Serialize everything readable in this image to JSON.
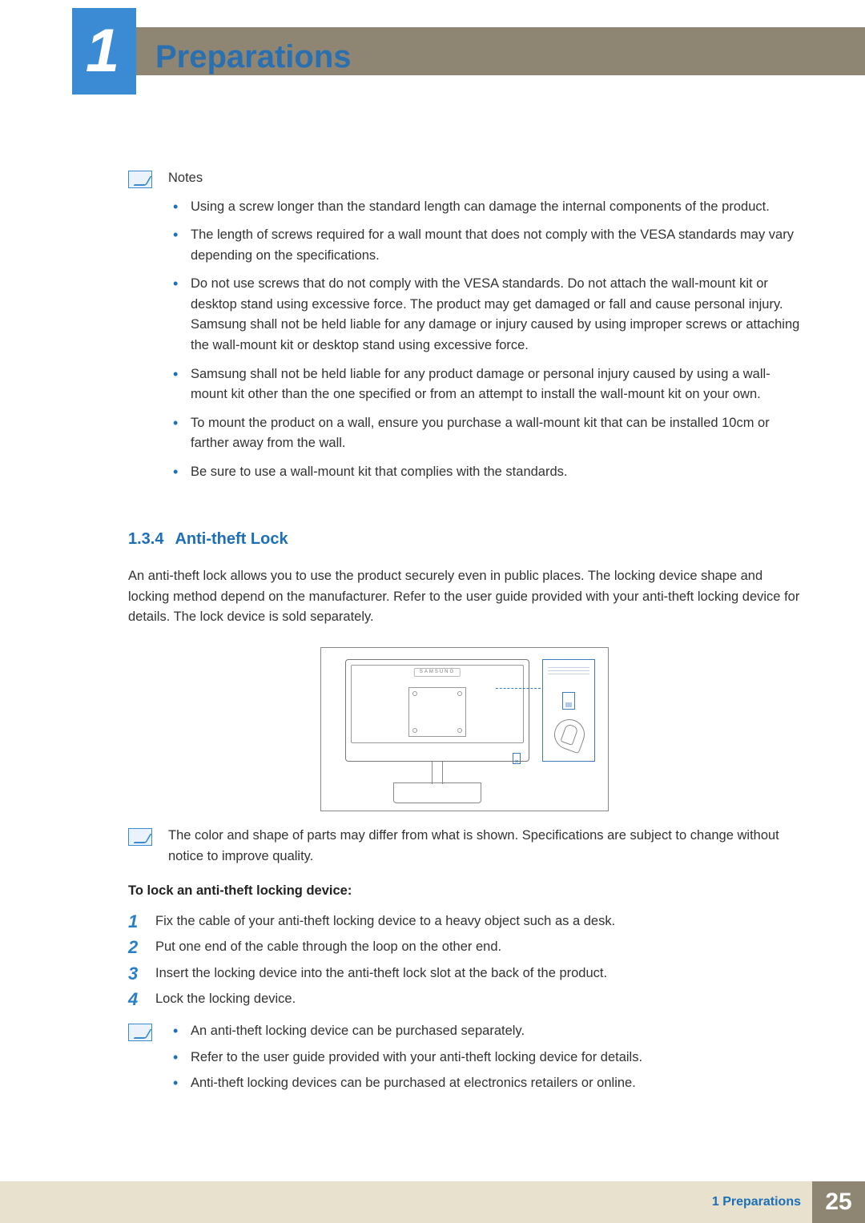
{
  "chapter": {
    "number": "1",
    "title": "Preparations"
  },
  "notesBlock": {
    "title": "Notes",
    "items": [
      "Using a screw longer than the standard length can damage the internal components of the product.",
      "The length of screws required for a wall mount that does not comply with the VESA standards may vary depending on the specifications.",
      "Do not use screws that do not comply with the VESA standards. Do not attach the wall-mount kit or desktop stand using excessive force. The product may get damaged or fall and cause personal injury. Samsung shall not be held liable for any damage or injury caused by using improper screws or attaching the wall-mount kit or desktop stand using excessive force.",
      "Samsung shall not be held liable for any product damage or personal injury caused by using a wall-mount kit other than the one specified or from an attempt to install the wall-mount kit on your own.",
      "To mount the product on a wall, ensure you purchase a wall-mount kit that can be installed 10cm or farther away from the wall.",
      "Be sure to use a wall-mount kit that complies with the standards."
    ]
  },
  "section": {
    "number": "1.3.4",
    "title": "Anti-theft Lock",
    "intro": "An anti-theft lock allows you to use the product securely even in public places. The locking device shape and locking method depend on the manufacturer. Refer to the user guide provided with your anti-theft locking device for details. The lock device is sold separately."
  },
  "diagram": {
    "monitorLabel": "SAMSUNG"
  },
  "note2": "The color and shape of parts may differ from what is shown. Specifications are subject to change without notice to improve quality.",
  "instr": {
    "title": "To lock an anti-theft locking device:",
    "steps": [
      "Fix the cable of your anti-theft locking device to a heavy object such as a desk.",
      "Put one end of the cable through the loop on the other end.",
      "Insert the locking device into the anti-theft lock slot at the back of the product.",
      "Lock the locking device."
    ]
  },
  "note3": {
    "items": [
      "An anti-theft locking device can be purchased separately.",
      "Refer to the user guide provided with your anti-theft locking device for details.",
      "Anti-theft locking devices can be purchased at electronics retailers or online."
    ]
  },
  "footer": {
    "chapterRef": "1 Preparations",
    "page": "25"
  }
}
